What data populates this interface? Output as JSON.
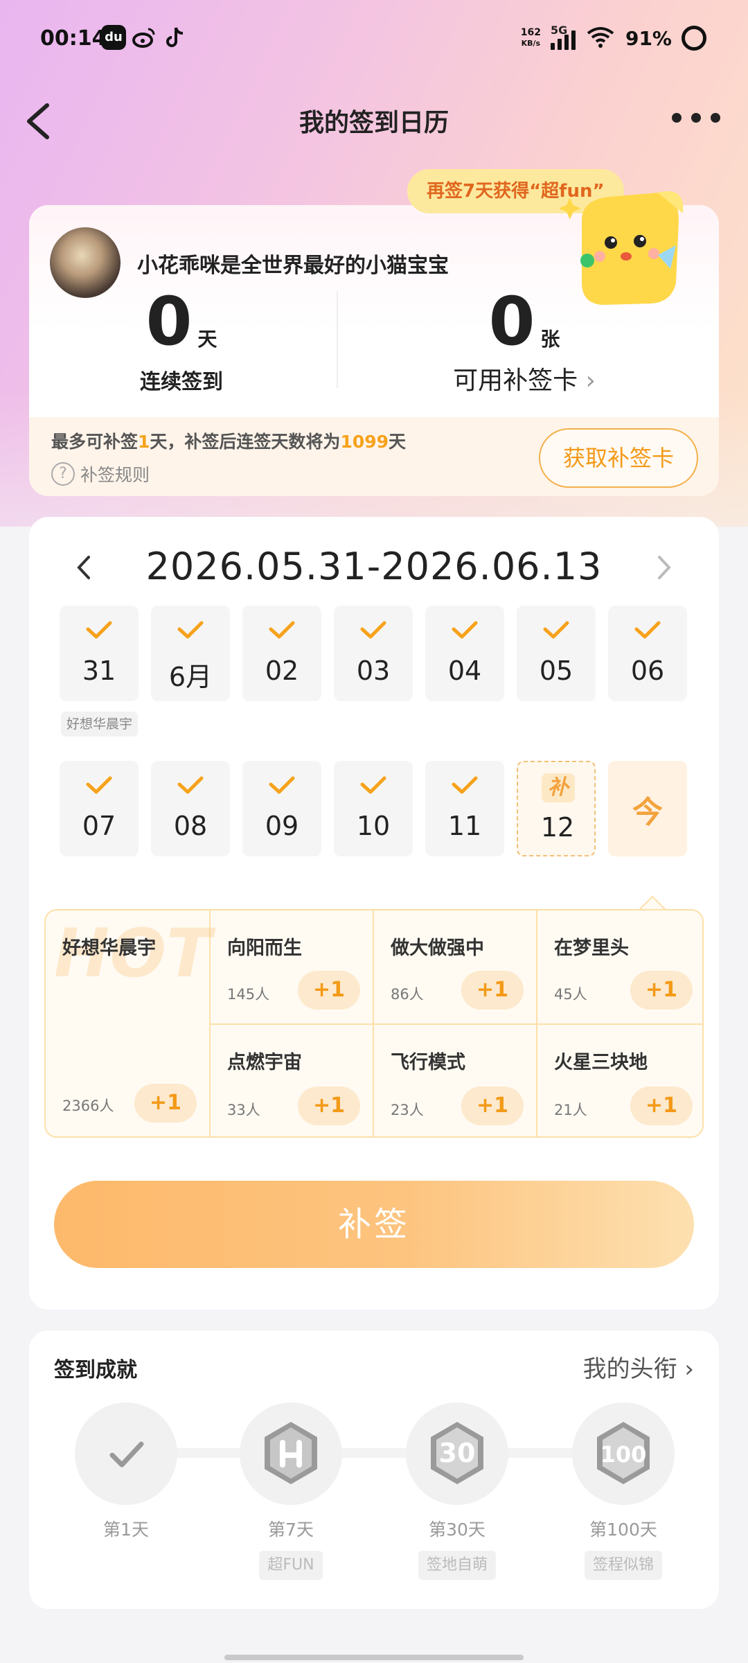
{
  "status_bar": {
    "time": "00:14",
    "net_speed_value": "162",
    "net_speed_unit": "KB/s",
    "network": "5G",
    "battery": "91%",
    "app_icons": [
      "du-app-icon",
      "weibo-icon",
      "tiktok-icon"
    ]
  },
  "header": {
    "title": "我的签到日历"
  },
  "profile": {
    "username": "小花乖咪是全世界最好的小猫宝宝",
    "bubble": "再签7天获得“超fun”",
    "streak_value": "0",
    "streak_unit": "天",
    "streak_label": "连续签到",
    "cards_value": "0",
    "cards_unit": "张",
    "cards_label": "可用补签卡",
    "cards_arrow": "›",
    "makeup_prefix": "最多可补签",
    "makeup_days": "1",
    "makeup_mid": "天，补签后连签天数将为",
    "makeup_total": "1099",
    "makeup_suffix": "天",
    "rules_label": "补签规则",
    "get_card_button": "获取补签卡"
  },
  "calendar": {
    "range": "2026.05.31-2026.06.13",
    "week1": [
      "31",
      "6月",
      "02",
      "03",
      "04",
      "05",
      "06"
    ],
    "week1_tag": "好想华晨宇",
    "week2": [
      "07",
      "08",
      "09",
      "10",
      "11"
    ],
    "makeup_day": "12",
    "makeup_mark": "补",
    "today_mark": "今"
  },
  "recommend": {
    "featured": {
      "name": "好想华晨宇",
      "count": "2366人",
      "plus": "+1",
      "hot": "HOT"
    },
    "items": [
      {
        "name": "向阳而生",
        "count": "145人",
        "plus": "+1"
      },
      {
        "name": "做大做强中",
        "count": "86人",
        "plus": "+1"
      },
      {
        "name": "在梦里头",
        "count": "45人",
        "plus": "+1"
      },
      {
        "name": "点燃宇宙",
        "count": "33人",
        "plus": "+1"
      },
      {
        "name": "飞行模式",
        "count": "23人",
        "plus": "+1"
      },
      {
        "name": "火星三块地",
        "count": "21人",
        "plus": "+1"
      }
    ]
  },
  "makeup_button": "补签",
  "achievements": {
    "title": "签到成就",
    "link": "我的头衔 ›",
    "badges": [
      {
        "label": "第1天",
        "tag": ""
      },
      {
        "label": "第7天",
        "tag": "超FUN"
      },
      {
        "label": "第30天",
        "tag": "签地自萌"
      },
      {
        "label": "第100天",
        "tag": "签程似锦"
      }
    ]
  },
  "colors": {
    "accent": "#f39a18",
    "check": "#f7a21b",
    "button_gradient_start": "#fdb96b"
  }
}
